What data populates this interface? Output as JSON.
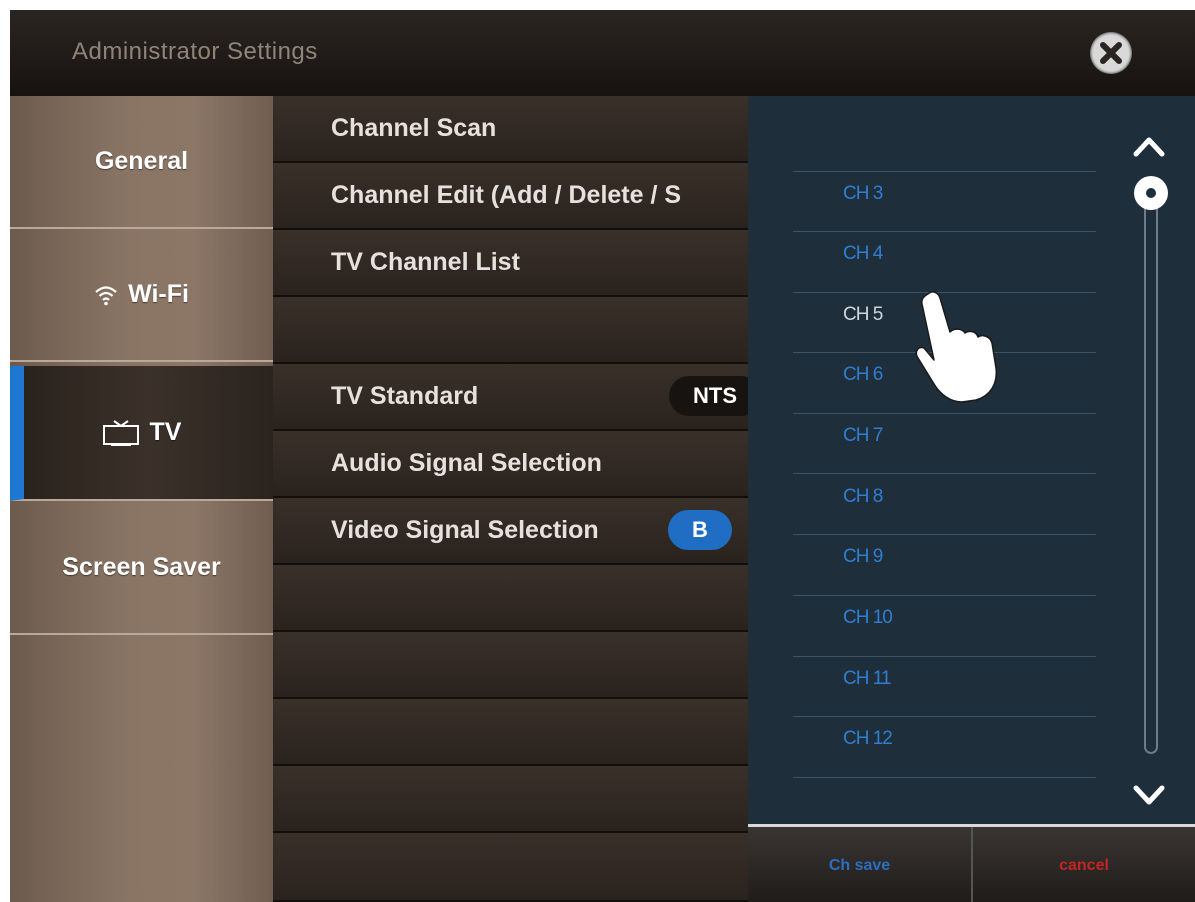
{
  "header": {
    "title": "Administrator Settings"
  },
  "sidebar": {
    "items": [
      {
        "label": "General",
        "icon": ""
      },
      {
        "label": "Wi-Fi",
        "icon": "wifi-icon"
      },
      {
        "label": "TV",
        "icon": "tv-icon"
      },
      {
        "label": "Screen Saver",
        "icon": ""
      }
    ],
    "active": "TV",
    "accent_color": "#1f78d0"
  },
  "main": {
    "rows": [
      {
        "label": "Channel Scan"
      },
      {
        "label": "Channel  Edit (Add / Delete / S"
      },
      {
        "label": "TV Channel List"
      },
      {
        "label": ""
      },
      {
        "label": "TV Standard",
        "value": "NTS"
      },
      {
        "label": "Audio Signal Selection"
      },
      {
        "label": "Video Signal Selection",
        "value": "B"
      }
    ]
  },
  "channels": {
    "items": [
      "CH 3",
      "CH 4",
      "CH 5",
      "CH 6",
      "CH 7",
      "CH 8",
      "CH 9",
      "CH 10",
      "CH 11",
      "CH 12"
    ],
    "selected": "CH 5",
    "channel_color": "#2f7ed2"
  },
  "buttons": {
    "save": "Ch save",
    "cancel": "cancel"
  }
}
